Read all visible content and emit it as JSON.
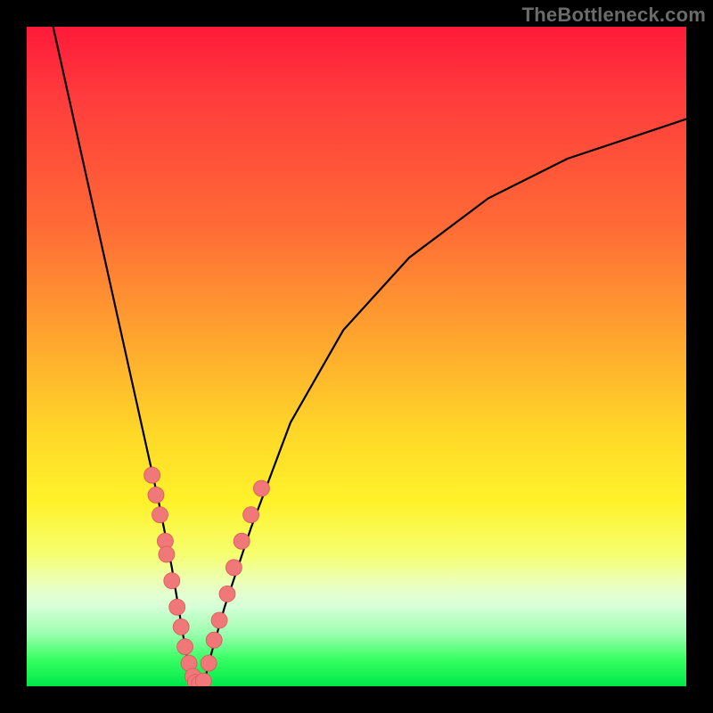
{
  "watermark": "TheBottleneck.com",
  "colors": {
    "gradient_top": "#ff1a3a",
    "gradient_bottom": "#00e84a",
    "curve": "#000000",
    "dots": "#f07878",
    "frame": "#000000"
  },
  "chart_data": {
    "type": "line",
    "title": "",
    "xlabel": "",
    "ylabel": "",
    "xlim": [
      0,
      100
    ],
    "ylim": [
      0,
      100
    ],
    "note": "No axes, ticks, or labels are rendered in the image. Values are estimated in percent of the plot area (0 = left/bottom, 100 = right/top).",
    "series": [
      {
        "name": "bottleneck-curve",
        "x": [
          4,
          8,
          12,
          16,
          20,
          22,
          23,
          24,
          25,
          26,
          27,
          28,
          30,
          34,
          40,
          48,
          58,
          70,
          82,
          94,
          100
        ],
        "y": [
          100,
          82,
          64,
          46,
          28,
          18,
          12,
          6,
          1,
          0,
          1,
          5,
          12,
          24,
          40,
          54,
          65,
          74,
          80,
          84,
          86
        ]
      }
    ],
    "scatter": [
      {
        "name": "dots-left-branch",
        "x": [
          19.0,
          19.6,
          20.2,
          21.0,
          21.2,
          22.0,
          22.8,
          23.4,
          24.0,
          24.6,
          25.2
        ],
        "y": [
          32.0,
          29.0,
          26.0,
          22.0,
          20.0,
          16.0,
          12.0,
          9.0,
          6.0,
          3.5,
          1.5
        ]
      },
      {
        "name": "dots-bottom",
        "x": [
          25.6,
          26.2,
          26.8
        ],
        "y": [
          0.6,
          0.4,
          0.8
        ]
      },
      {
        "name": "dots-right-branch",
        "x": [
          27.6,
          28.4,
          29.2,
          30.4,
          31.4,
          32.6,
          34.0,
          35.6
        ],
        "y": [
          3.5,
          7.0,
          10.0,
          14.0,
          18.0,
          22.0,
          26.0,
          30.0
        ]
      }
    ]
  }
}
